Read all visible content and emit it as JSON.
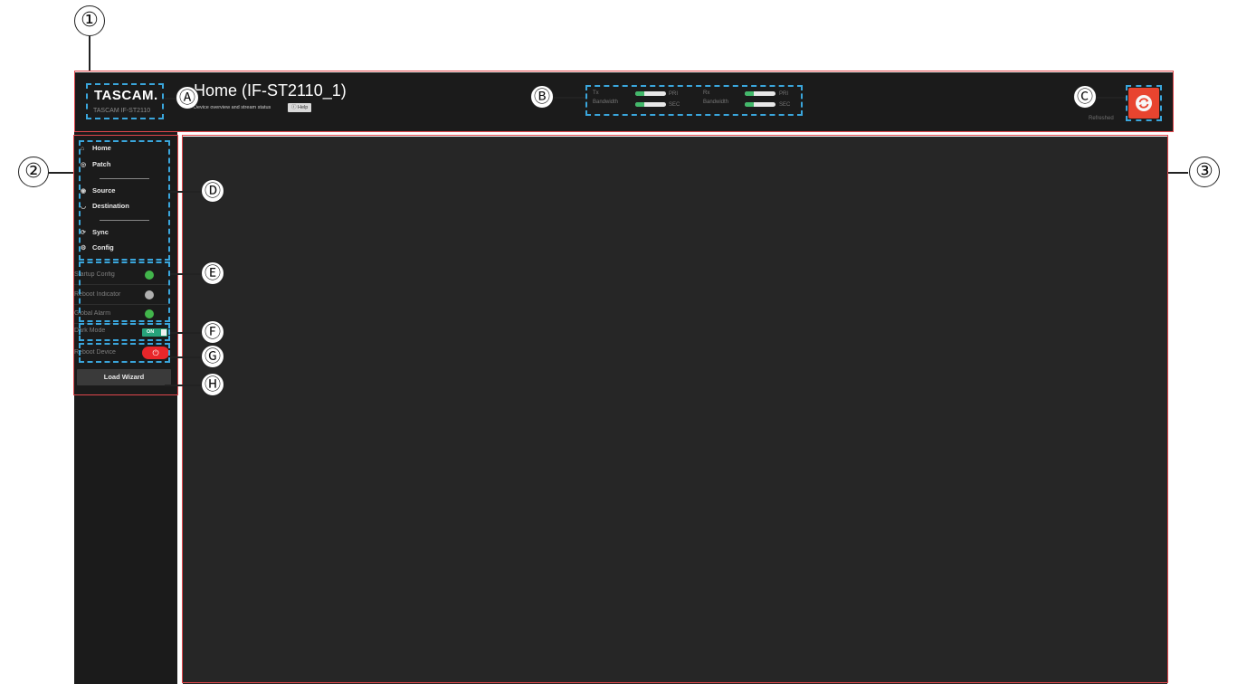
{
  "callouts": {
    "one": "①",
    "two": "②",
    "three": "③",
    "a": "Ⓐ",
    "b": "Ⓑ",
    "c": "Ⓒ",
    "d": "Ⓓ",
    "e": "Ⓔ",
    "f": "Ⓕ",
    "g": "Ⓖ",
    "h": "Ⓗ"
  },
  "header": {
    "logo": "TASCAM.",
    "model": "TASCAM IF-ST2110",
    "title": "Home (IF-ST2110_1)",
    "subtitle": "Device overview and stream status",
    "help_label": "Help",
    "help_icon": "info-icon",
    "refresh_icon": "refresh-icon",
    "refresh_label": "Refreshed"
  },
  "bandwidth": {
    "tx_label": "Tx",
    "rx_label": "Rx",
    "bandwidth_label": "Bandwidth",
    "pri_label": "PRI",
    "sec_label": "SEC",
    "tx_pri_level": 0.3,
    "tx_sec_level": 0.3,
    "rx_pri_level": 0.3,
    "rx_sec_level": 0.3,
    "fill_color": "#42b86a",
    "track_color": "#e8e8e8"
  },
  "nav": {
    "items": [
      {
        "label": "Home",
        "icon": "home-icon"
      },
      {
        "label": "Patch",
        "icon": "patch-icon"
      },
      {
        "label": "Source",
        "icon": "speaker-icon"
      },
      {
        "label": "Destination",
        "icon": "headphones-icon"
      },
      {
        "label": "Sync",
        "icon": "sync-icon"
      },
      {
        "label": "Config",
        "icon": "gears-icon"
      }
    ]
  },
  "status": {
    "startup_config": {
      "label": "Startup Config",
      "color": "#42b54b"
    },
    "reboot_indicator": {
      "label": "Reboot Indicator",
      "color": "#b0b0b0"
    },
    "global_alarm": {
      "label": "Global Alarm",
      "color": "#42b54b"
    }
  },
  "dark_mode": {
    "label": "Dark Mode",
    "state": "ON"
  },
  "reboot": {
    "label": "Reboot Device",
    "icon": "power-icon",
    "color": "#e8262a"
  },
  "wizard": {
    "label": "Load Wizard"
  },
  "colors": {
    "callout_box": "#e0474c",
    "callout_dash": "#3aa6dc",
    "panel_bg": "#1b1b1b",
    "main_bg": "#262626"
  }
}
